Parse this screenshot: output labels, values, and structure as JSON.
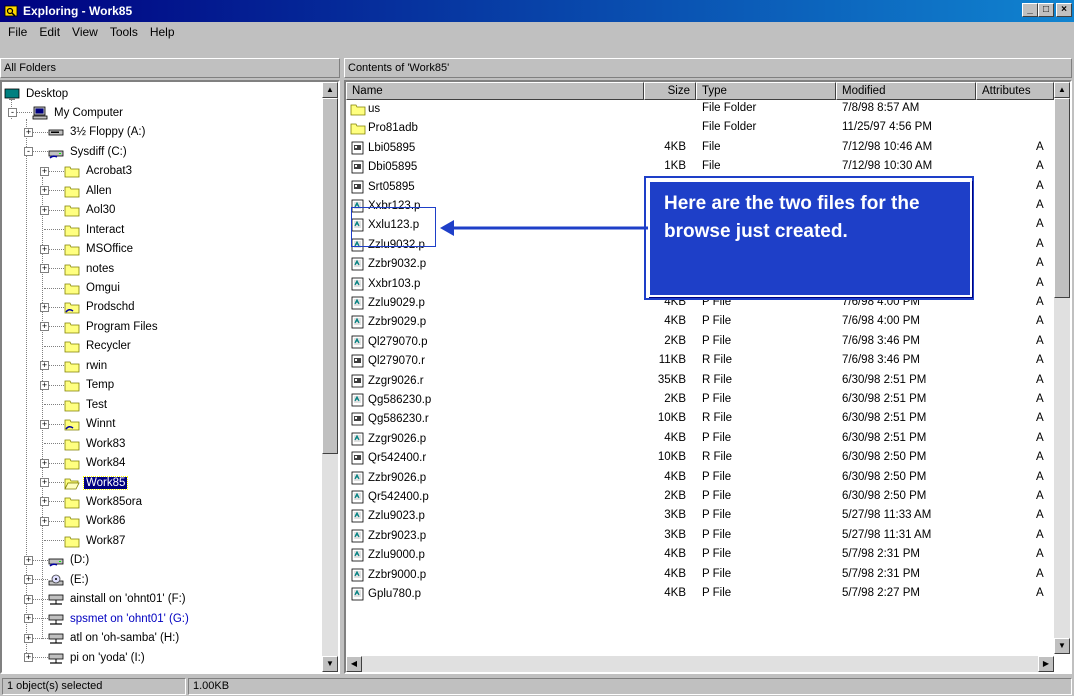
{
  "window": {
    "title": "Exploring - Work85",
    "min": "_",
    "max": "□",
    "close": "×"
  },
  "menu": [
    "File",
    "Edit",
    "View",
    "Tools",
    "Help"
  ],
  "left_header": "All Folders",
  "right_header": "Contents of 'Work85'",
  "tree": [
    {
      "label": "Desktop",
      "icon": "desktop-icon",
      "level": 0
    },
    {
      "label": "My Computer",
      "icon": "computer-icon",
      "level": 1,
      "exp": "-"
    },
    {
      "label": "3½ Floppy (A:)",
      "icon": "floppy-icon",
      "level": 2,
      "exp": "+"
    },
    {
      "label": "Sysdiff (C:)",
      "icon": "drive-icon",
      "level": 2,
      "exp": "-"
    },
    {
      "label": "Acrobat3",
      "icon": "folder-icon",
      "level": 3,
      "exp": "+"
    },
    {
      "label": "Allen",
      "icon": "folder-icon",
      "level": 3,
      "exp": "+"
    },
    {
      "label": "Aol30",
      "icon": "folder-icon",
      "level": 3,
      "exp": "+"
    },
    {
      "label": "Interact",
      "icon": "folder-icon",
      "level": 3
    },
    {
      "label": "MSOffice",
      "icon": "folder-icon",
      "level": 3,
      "exp": "+"
    },
    {
      "label": "notes",
      "icon": "folder-icon",
      "level": 3,
      "exp": "+"
    },
    {
      "label": "Omgui",
      "icon": "folder-icon",
      "level": 3
    },
    {
      "label": "Prodschd",
      "icon": "shared-folder-icon",
      "level": 3,
      "exp": "+"
    },
    {
      "label": "Program Files",
      "icon": "folder-icon",
      "level": 3,
      "exp": "+"
    },
    {
      "label": "Recycler",
      "icon": "folder-icon",
      "level": 3
    },
    {
      "label": "rwin",
      "icon": "folder-icon",
      "level": 3,
      "exp": "+"
    },
    {
      "label": "Temp",
      "icon": "folder-icon",
      "level": 3,
      "exp": "+"
    },
    {
      "label": "Test",
      "icon": "folder-icon",
      "level": 3
    },
    {
      "label": "Winnt",
      "icon": "shared-folder-icon",
      "level": 3,
      "exp": "+"
    },
    {
      "label": "Work83",
      "icon": "folder-icon",
      "level": 3
    },
    {
      "label": "Work84",
      "icon": "folder-icon",
      "level": 3,
      "exp": "+"
    },
    {
      "label": "Work85",
      "icon": "open-folder-icon",
      "level": 3,
      "exp": "+",
      "selected": true
    },
    {
      "label": "Work85ora",
      "icon": "folder-icon",
      "level": 3,
      "exp": "+"
    },
    {
      "label": "Work86",
      "icon": "folder-icon",
      "level": 3,
      "exp": "+"
    },
    {
      "label": "Work87",
      "icon": "folder-icon",
      "level": 3
    },
    {
      "label": "(D:)",
      "icon": "drive-icon",
      "level": 2,
      "exp": "+"
    },
    {
      "label": "(E:)",
      "icon": "cdrom-icon",
      "level": 2,
      "exp": "+"
    },
    {
      "label": "ainstall on 'ohnt01' (F:)",
      "icon": "network-drive-icon",
      "level": 2,
      "exp": "+"
    },
    {
      "label": "spsmet on 'ohnt01' (G:)",
      "icon": "network-drive-icon",
      "level": 2,
      "exp": "+",
      "blue": true
    },
    {
      "label": "atl on 'oh-samba' (H:)",
      "icon": "network-drive-icon",
      "level": 2,
      "exp": "+"
    },
    {
      "label": "pi on 'yoda' (I:)",
      "icon": "network-drive-icon",
      "level": 2,
      "exp": "+"
    }
  ],
  "columns": [
    "Name",
    "Size",
    "Type",
    "Modified",
    "Attributes"
  ],
  "files": [
    {
      "name": "us",
      "size": "",
      "type": "File Folder",
      "modified": "7/8/98 8:57 AM",
      "attr": "",
      "icon": "folder-icon"
    },
    {
      "name": "Pro81adb",
      "size": "",
      "type": "File Folder",
      "modified": "11/25/97 4:56 PM",
      "attr": "",
      "icon": "folder-icon"
    },
    {
      "name": "Lbi05895",
      "size": "4KB",
      "type": "File",
      "modified": "7/12/98 10:46 AM",
      "attr": "A",
      "icon": "file-icon"
    },
    {
      "name": "Dbi05895",
      "size": "1KB",
      "type": "File",
      "modified": "7/12/98 10:30 AM",
      "attr": "A",
      "icon": "file-icon"
    },
    {
      "name": "Srt05895",
      "size": "",
      "type": "",
      "modified": "",
      "attr": "A",
      "icon": "file-icon"
    },
    {
      "name": "Xxbr123.p",
      "size": "",
      "type": "",
      "modified": "",
      "attr": "A",
      "icon": "p-file-icon"
    },
    {
      "name": "Xxlu123.p",
      "size": "",
      "type": "",
      "modified": "",
      "attr": "A",
      "icon": "p-file-icon"
    },
    {
      "name": "Zzlu9032.p",
      "size": "",
      "type": "",
      "modified": "",
      "attr": "A",
      "icon": "p-file-icon"
    },
    {
      "name": "Zzbr9032.p",
      "size": "",
      "type": "",
      "modified": "",
      "attr": "A",
      "icon": "p-file-icon"
    },
    {
      "name": "Xxbr103.p",
      "size": "",
      "type": "",
      "modified": "",
      "attr": "A",
      "icon": "p-file-icon"
    },
    {
      "name": "Zzlu9029.p",
      "size": "4KB",
      "type": "P File",
      "modified": "7/6/98 4:00 PM",
      "attr": "A",
      "icon": "p-file-icon"
    },
    {
      "name": "Zzbr9029.p",
      "size": "4KB",
      "type": "P File",
      "modified": "7/6/98 4:00 PM",
      "attr": "A",
      "icon": "p-file-icon"
    },
    {
      "name": "Ql279070.p",
      "size": "2KB",
      "type": "P File",
      "modified": "7/6/98 3:46 PM",
      "attr": "A",
      "icon": "p-file-icon"
    },
    {
      "name": "Ql279070.r",
      "size": "11KB",
      "type": "R File",
      "modified": "7/6/98 3:46 PM",
      "attr": "A",
      "icon": "file-icon"
    },
    {
      "name": "Zzgr9026.r",
      "size": "35KB",
      "type": "R File",
      "modified": "6/30/98 2:51 PM",
      "attr": "A",
      "icon": "file-icon"
    },
    {
      "name": "Qg586230.p",
      "size": "2KB",
      "type": "P File",
      "modified": "6/30/98 2:51 PM",
      "attr": "A",
      "icon": "p-file-icon"
    },
    {
      "name": "Qg586230.r",
      "size": "10KB",
      "type": "R File",
      "modified": "6/30/98 2:51 PM",
      "attr": "A",
      "icon": "file-icon"
    },
    {
      "name": "Zzgr9026.p",
      "size": "4KB",
      "type": "P File",
      "modified": "6/30/98 2:51 PM",
      "attr": "A",
      "icon": "p-file-icon"
    },
    {
      "name": "Qr542400.r",
      "size": "10KB",
      "type": "R File",
      "modified": "6/30/98 2:50 PM",
      "attr": "A",
      "icon": "file-icon"
    },
    {
      "name": "Zzbr9026.p",
      "size": "4KB",
      "type": "P File",
      "modified": "6/30/98 2:50 PM",
      "attr": "A",
      "icon": "p-file-icon"
    },
    {
      "name": "Qr542400.p",
      "size": "2KB",
      "type": "P File",
      "modified": "6/30/98 2:50 PM",
      "attr": "A",
      "icon": "p-file-icon"
    },
    {
      "name": "Zzlu9023.p",
      "size": "3KB",
      "type": "P File",
      "modified": "5/27/98 11:33 AM",
      "attr": "A",
      "icon": "p-file-icon"
    },
    {
      "name": "Zzbr9023.p",
      "size": "3KB",
      "type": "P File",
      "modified": "5/27/98 11:31 AM",
      "attr": "A",
      "icon": "p-file-icon"
    },
    {
      "name": "Zzlu9000.p",
      "size": "4KB",
      "type": "P File",
      "modified": "5/7/98 2:31 PM",
      "attr": "A",
      "icon": "p-file-icon"
    },
    {
      "name": "Zzbr9000.p",
      "size": "4KB",
      "type": "P File",
      "modified": "5/7/98 2:31 PM",
      "attr": "A",
      "icon": "p-file-icon"
    },
    {
      "name": "Gplu780.p",
      "size": "4KB",
      "type": "P File",
      "modified": "5/7/98 2:27 PM",
      "attr": "A",
      "icon": "p-file-icon"
    }
  ],
  "callout": "Here are the two files for the browse just created.",
  "status": {
    "selected": "1 object(s) selected",
    "size": "1.00KB"
  },
  "colors": {
    "title_from": "#000080",
    "title_to": "#1084d0",
    "callout_bg": "#1e3fc8",
    "selection": "#000080"
  }
}
